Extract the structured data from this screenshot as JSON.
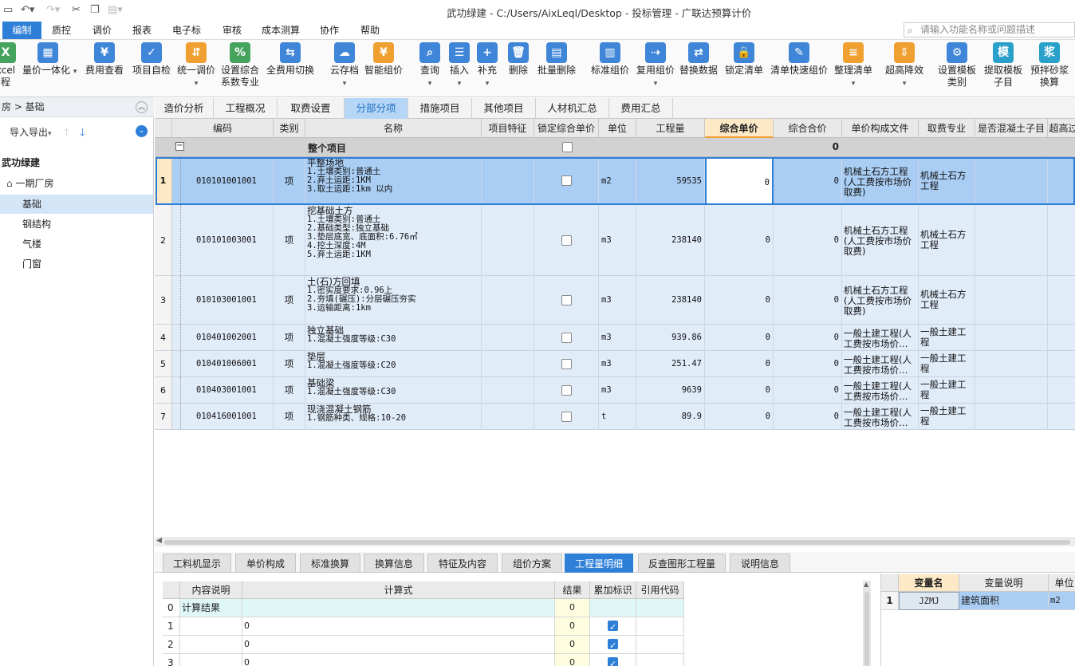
{
  "window": {
    "title": "武功绿建 - C:/Users/AixLeql/Desktop - 投标管理 - 广联达预算计价"
  },
  "menubar": {
    "items": [
      "编制",
      "质控",
      "调价",
      "报表",
      "电子标",
      "审核",
      "成本测算",
      "协作",
      "帮助"
    ],
    "active": "编制",
    "search_placeholder": "请输入功能名称或问题描述"
  },
  "ribbon": {
    "buttons": [
      {
        "label": "xcel",
        "label2": "程",
        "icon": "excel-icon"
      },
      {
        "label": "量价一体化",
        "icon": "integration-icon"
      },
      {
        "label": "费用查看",
        "icon": "fee-view-icon"
      },
      {
        "label": "项目自检",
        "icon": "self-check-icon"
      },
      {
        "label": "统一调价",
        "icon": "price-adjust-icon"
      },
      {
        "label": "设置综合",
        "label2": "系数专业",
        "icon": "coefficient-icon"
      },
      {
        "label": "全费用切换",
        "icon": "full-fee-switch-icon"
      },
      {
        "label": "云存档",
        "icon": "cloud-archive-icon"
      },
      {
        "label": "智能组价",
        "icon": "smart-pricing-icon"
      },
      {
        "label": "查询",
        "icon": "query-icon"
      },
      {
        "label": "插入",
        "icon": "insert-icon"
      },
      {
        "label": "补充",
        "icon": "supplement-icon"
      },
      {
        "label": "删除",
        "icon": "delete-icon"
      },
      {
        "label": "批量删除",
        "icon": "batch-delete-icon"
      },
      {
        "label": "标准组价",
        "icon": "standard-pricing-icon"
      },
      {
        "label": "复用组价",
        "icon": "reuse-pricing-icon"
      },
      {
        "label": "替换数据",
        "icon": "replace-data-icon"
      },
      {
        "label": "锁定清单",
        "icon": "lock-icon"
      },
      {
        "label": "清单快速组价",
        "icon": "quick-pricing-icon"
      },
      {
        "label": "整理清单",
        "icon": "organize-list-icon"
      },
      {
        "label": "超高降效",
        "icon": "high-efficiency-icon"
      },
      {
        "label": "设置模板",
        "label2": "类别",
        "icon": "template-icon"
      },
      {
        "label": "提取模板",
        "label2": "子目",
        "icon": "extract-template-icon"
      },
      {
        "label": "预拌砂浆",
        "label2": "换算",
        "icon": "mortar-icon"
      }
    ]
  },
  "left_panel": {
    "breadcrumb": "房 > 基础",
    "import_export": "导入导出",
    "project": "武功绿建",
    "tree": [
      {
        "label": "一期厂房",
        "level": 1,
        "selected": false
      },
      {
        "label": "基础",
        "level": 2,
        "selected": true
      },
      {
        "label": "钢结构",
        "level": 2,
        "selected": false
      },
      {
        "label": "气楼",
        "level": 2,
        "selected": false
      },
      {
        "label": "门窗",
        "level": 2,
        "selected": false
      }
    ]
  },
  "tabs": {
    "items": [
      "造价分析",
      "工程概况",
      "取费设置",
      "分部分项",
      "措施项目",
      "其他项目",
      "人材机汇总",
      "费用汇总"
    ],
    "active": "分部分项"
  },
  "grid": {
    "headers": [
      "编码",
      "类别",
      "名称",
      "项目特征",
      "锁定综合单价",
      "单位",
      "工程量",
      "综合单价",
      "综合合价",
      "单价构成文件",
      "取费专业",
      "是否混凝土子目",
      "超高过"
    ],
    "summary_row": {
      "name": "整个项目",
      "total": "0"
    },
    "rows": [
      {
        "num": "1",
        "code": "010101001001",
        "type": "项",
        "name": "平整场地",
        "features": [
          "1.土壤类别:普通土",
          "2.弃土运距:1KM",
          "3.取土运距:1km 以内"
        ],
        "unit": "m2",
        "qty": "59535",
        "price": "0",
        "total": "0",
        "file": "机械土石方工程(人工费按市场价取费)",
        "major": "机械土石方工程",
        "selected": true
      },
      {
        "num": "2",
        "code": "010101003001",
        "type": "项",
        "name": "挖基础土方",
        "features": [
          "1.土壤类别:普通土",
          "2.基础类型:独立基础",
          "3.垫层底宽、底面积:6.76㎡",
          "4.挖土深度:4M",
          "5.弃土运距:1KM"
        ],
        "unit": "m3",
        "qty": "238140",
        "price": "0",
        "total": "0",
        "file": "机械土石方工程(人工费按市场价取费)",
        "major": "机械土石方工程",
        "selected": false
      },
      {
        "num": "3",
        "code": "010103001001",
        "type": "项",
        "name": "土(石)方回填",
        "features": [
          "1.密实度要求:0.96上",
          "2.夯填(碾压):分层碾压夯实",
          "3.运输距离:1km"
        ],
        "unit": "m3",
        "qty": "238140",
        "price": "0",
        "total": "0",
        "file": "机械土石方工程(人工费按市场价取费)",
        "major": "机械土石方工程",
        "selected": false
      },
      {
        "num": "4",
        "code": "010401002001",
        "type": "项",
        "name": "独立基础",
        "features": [
          "1.混凝土强度等级:C30"
        ],
        "unit": "m3",
        "qty": "939.86",
        "price": "0",
        "total": "0",
        "file": "一般土建工程(人工费按市场价…",
        "major": "一般土建工程",
        "selected": false
      },
      {
        "num": "5",
        "code": "010401006001",
        "type": "项",
        "name": "垫层",
        "features": [
          "1.混凝土强度等级:C20"
        ],
        "unit": "m3",
        "qty": "251.47",
        "price": "0",
        "total": "0",
        "file": "一般土建工程(人工费按市场价…",
        "major": "一般土建工程",
        "selected": false
      },
      {
        "num": "6",
        "code": "010403001001",
        "type": "项",
        "name": "基础梁",
        "features": [
          "1.混凝土强度等级:C30"
        ],
        "unit": "m3",
        "qty": "9639",
        "price": "0",
        "total": "0",
        "file": "一般土建工程(人工费按市场价…",
        "major": "一般土建工程",
        "selected": false
      },
      {
        "num": "7",
        "code": "010416001001",
        "type": "项",
        "name": "现浇混凝土钢筋",
        "features": [
          "1.钢筋种类、规格:10-20"
        ],
        "unit": "t",
        "qty": "89.9",
        "price": "0",
        "total": "0",
        "file": "一般土建工程(人工费按市场价…",
        "major": "一般土建工程",
        "selected": false
      }
    ]
  },
  "bottom_tabs": {
    "items": [
      "工料机显示",
      "单价构成",
      "标准换算",
      "换算信息",
      "特征及内容",
      "组价方案",
      "工程量明细",
      "反查图形工程量",
      "说明信息"
    ],
    "active": "工程量明细"
  },
  "detail_grid": {
    "headers": [
      "内容说明",
      "计算式",
      "结果",
      "累加标识",
      "引用代码"
    ],
    "rows": [
      {
        "num": "0",
        "desc": "计算结果",
        "formula": "",
        "result": "0",
        "checked": false
      },
      {
        "num": "1",
        "desc": "",
        "formula": "0",
        "result": "0",
        "checked": true
      },
      {
        "num": "2",
        "desc": "",
        "formula": "0",
        "result": "0",
        "checked": true
      },
      {
        "num": "3",
        "desc": "",
        "formula": "0",
        "result": "0",
        "checked": true
      }
    ]
  },
  "variable_grid": {
    "headers": [
      "变量名",
      "变量说明",
      "单位"
    ],
    "rows": [
      {
        "num": "1",
        "name": "JZMJ",
        "desc": "建筑面积",
        "unit": "m2"
      }
    ]
  }
}
